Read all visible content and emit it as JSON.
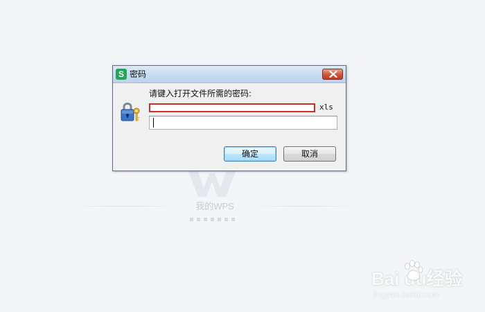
{
  "dialog": {
    "title": "密码",
    "app_icon_letter": "S",
    "prompt": "请键入打开文件所需的密码:",
    "file_extension": "xls",
    "filename_value": "",
    "password_value": "",
    "ok_label": "确定",
    "cancel_label": "取消"
  },
  "background": {
    "brand": "我的WPS"
  },
  "watermark": {
    "logo_text": "Bai  du经验",
    "url": "jingyan.baidu.com"
  },
  "colors": {
    "highlight_border": "#d22b2b",
    "app_icon": "#21a556",
    "close_button": "#c33d22"
  },
  "icons": {
    "app": "wps-spreadsheet-icon",
    "close": "close-icon",
    "lock": "lock-key-icon"
  }
}
